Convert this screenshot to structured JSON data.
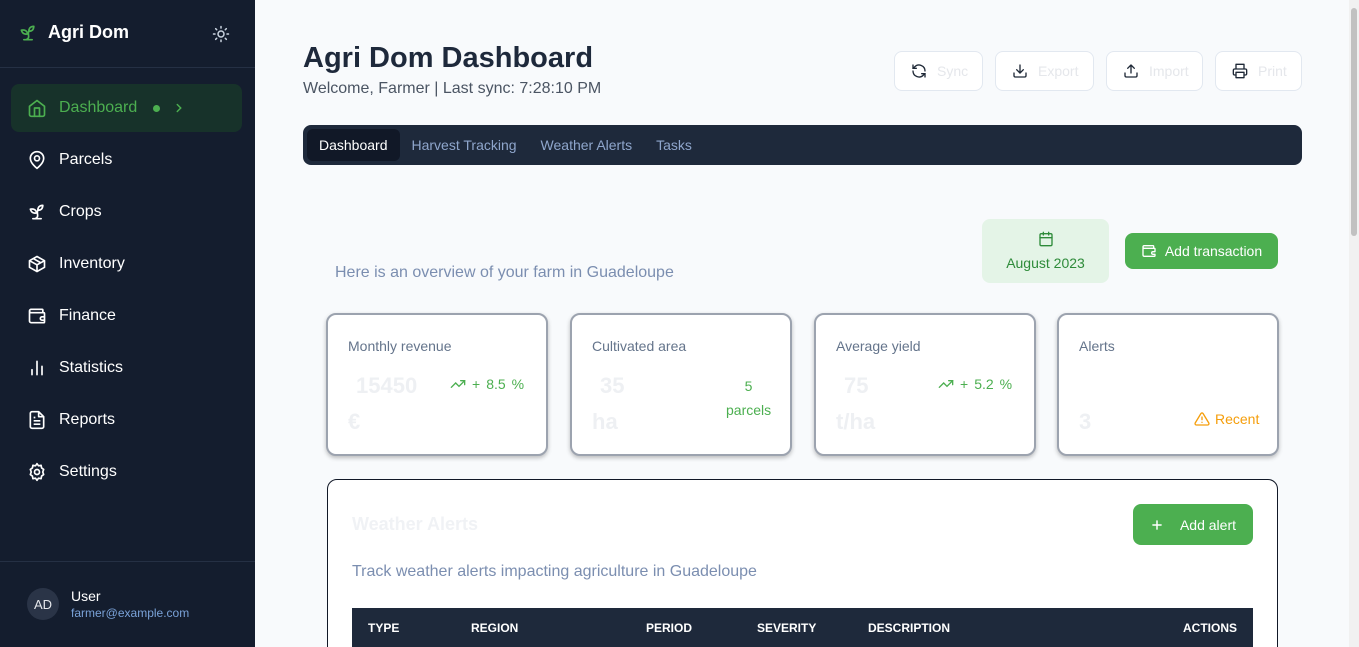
{
  "sidebar": {
    "brand": "Agri Dom",
    "items": [
      {
        "label": "Dashboard",
        "icon": "home-icon",
        "active": true
      },
      {
        "label": "Parcels",
        "icon": "map-pin-icon"
      },
      {
        "label": "Crops",
        "icon": "sprout-icon"
      },
      {
        "label": "Inventory",
        "icon": "package-icon"
      },
      {
        "label": "Finance",
        "icon": "wallet-icon"
      },
      {
        "label": "Statistics",
        "icon": "bar-chart-icon"
      },
      {
        "label": "Reports",
        "icon": "file-text-icon"
      },
      {
        "label": "Settings",
        "icon": "settings-icon"
      }
    ],
    "user": {
      "initials": "AD",
      "name": "User",
      "email": "farmer@example.com"
    }
  },
  "header": {
    "title": "Agri Dom Dashboard",
    "subtitle": "Welcome, Farmer | Last sync: 7:28:10 PM",
    "buttons": {
      "sync": "Sync",
      "export": "Export",
      "import": "Import",
      "print": "Print"
    }
  },
  "tabs": [
    "Dashboard",
    "Harvest Tracking",
    "Weather Alerts",
    "Tasks"
  ],
  "overview": {
    "text": "Here is an overview of your farm in Guadeloupe",
    "month": "August 2023",
    "add_transaction": "Add transaction"
  },
  "stats": {
    "revenue": {
      "title": "Monthly revenue",
      "value": "15450",
      "unit": "€",
      "trend_sign": "+",
      "trend_value": "8.5",
      "trend_unit": "%"
    },
    "area": {
      "title": "Cultivated area",
      "value": "35",
      "unit": "ha",
      "note_count": "5",
      "note_label": "parcels"
    },
    "yield": {
      "title": "Average yield",
      "value": "75",
      "unit": "t/ha",
      "trend_sign": "+",
      "trend_value": "5.2",
      "trend_unit": "%"
    },
    "alerts": {
      "title": "Alerts",
      "value": "3",
      "badge": "Recent"
    }
  },
  "weather": {
    "title": "Weather Alerts",
    "subtitle": "Track weather alerts impacting agriculture in Guadeloupe",
    "add_alert": "Add alert",
    "columns": [
      "TYPE",
      "REGION",
      "PERIOD",
      "SEVERITY",
      "DESCRIPTION",
      "ACTIONS"
    ]
  },
  "colors": {
    "accent": "#4caf50",
    "sidebar": "#141d2e",
    "warning": "#f59e0b"
  }
}
